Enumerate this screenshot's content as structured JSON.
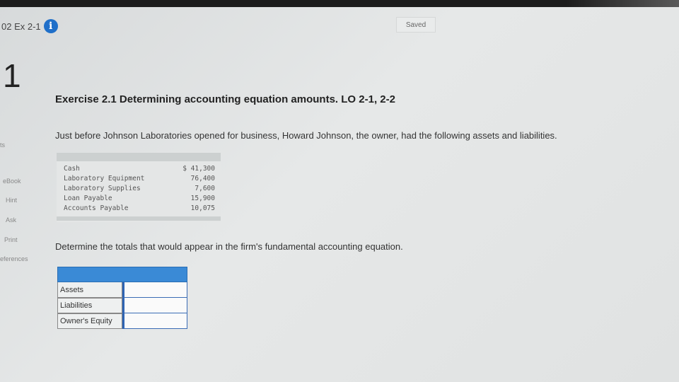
{
  "header": {
    "crumb": "02 Ex 2-1",
    "saved": "Saved"
  },
  "sidebar": {
    "question_number": "1",
    "partial_label": "ts",
    "links": [
      "eBook",
      "Hint",
      "Ask",
      "Print",
      "eferences"
    ]
  },
  "exercise": {
    "title": "Exercise 2.1 Determining accounting equation amounts. LO 2-1, 2-2",
    "intro": "Just before Johnson Laboratories opened for business, Howard Johnson, the owner, had the following assets and liabilities.",
    "items": [
      {
        "label": "Cash",
        "amount": "$ 41,300"
      },
      {
        "label": "Laboratory Equipment",
        "amount": "76,400"
      },
      {
        "label": "Laboratory Supplies",
        "amount": "7,600"
      },
      {
        "label": "Loan Payable",
        "amount": "15,900"
      },
      {
        "label": "Accounts Payable",
        "amount": "10,075"
      }
    ],
    "prompt": "Determine the totals that would appear in the firm's fundamental accounting equation."
  },
  "answer_table": {
    "rows": [
      {
        "label": "Assets",
        "value": ""
      },
      {
        "label": "Liabilities",
        "value": ""
      },
      {
        "label": "Owner's Equity",
        "value": ""
      }
    ]
  },
  "colors": {
    "accent": "#3a8ad6",
    "info_icon": "#1f6fc9"
  },
  "icons": {
    "info": "info-icon"
  }
}
